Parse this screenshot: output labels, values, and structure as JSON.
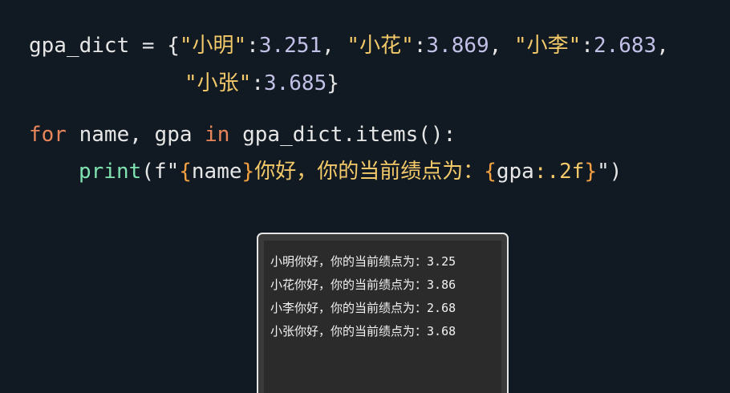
{
  "code": {
    "line1": {
      "var": "gpa_dict",
      "eq": " = ",
      "open": "{",
      "k1": "\"小明\"",
      "c1": ":",
      "v1": "3.251",
      "s1": ", ",
      "k2": "\"小花\"",
      "c2": ":",
      "v2": "3.869",
      "s2": ", ",
      "k3": "\"小李\"",
      "c3": ":",
      "v3": "2.683",
      "s3": ","
    },
    "line2": {
      "k4": "\"小张\"",
      "c4": ":",
      "v4": "3.685",
      "close": "}"
    },
    "line3": {
      "for": "for",
      "mid": " name, gpa ",
      "in": "in",
      "rest": " gpa_dict.items():"
    },
    "line4": {
      "print": "print",
      "paren_open": "(",
      "fprefix": "f\"",
      "brace1_open": "{",
      "name": "name",
      "brace1_close": "}",
      "text": "你好，你的当前绩点为：",
      "brace2_open": "{",
      "gpa": "gpa",
      "fmt": ":.2f",
      "brace2_close": "}",
      "quote_close": "\"",
      "paren_close": ")"
    }
  },
  "terminal": {
    "output": [
      "小明你好，你的当前绩点为：3.25",
      "小花你好，你的当前绩点为：3.86",
      "小李你好，你的当前绩点为：2.68",
      "小张你好，你的当前绩点为：3.68"
    ]
  },
  "colors": {
    "background": "#111a22",
    "keyword": "#e8855a",
    "string": "#f3c96a",
    "number": "#c3c0e8",
    "function": "#7fe3b0",
    "brace": "#f5a142"
  }
}
